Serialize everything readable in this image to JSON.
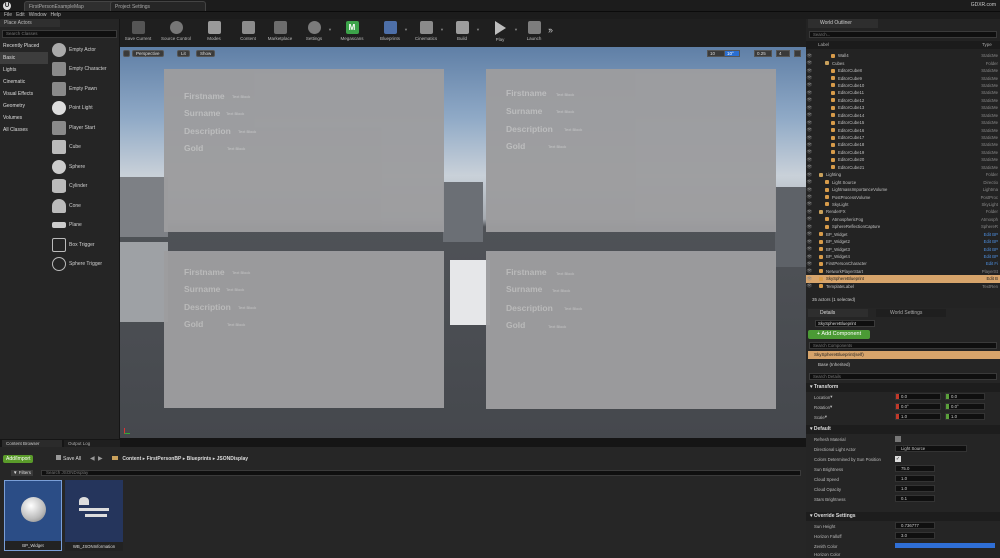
{
  "window": {
    "tabs": [
      "FirstPersonExampleMap",
      "Project Settings"
    ],
    "search": "Search For Help",
    "user": "GDXR.com",
    "fps_text": "11.5 ms"
  },
  "menu": [
    "File",
    "Edit",
    "Window",
    "Help"
  ],
  "toolbar": [
    {
      "label": "Save Current",
      "icon": "save-icon"
    },
    {
      "label": "Source Control",
      "icon": "source-control-icon"
    },
    {
      "label": "Modes",
      "icon": "modes-icon"
    },
    {
      "label": "Content",
      "icon": "content-icon"
    },
    {
      "label": "Marketplace",
      "icon": "marketplace-icon"
    },
    {
      "label": "Settings",
      "icon": "settings-icon"
    },
    {
      "label": "Megascans",
      "icon": "megascans-icon"
    },
    {
      "label": "Blueprints",
      "icon": "blueprints-icon"
    },
    {
      "label": "Cinematics",
      "icon": "cinematics-icon"
    },
    {
      "label": "Build",
      "icon": "build-icon"
    },
    {
      "label": "Play",
      "icon": "play-icon"
    },
    {
      "label": "Launch",
      "icon": "launch-icon"
    }
  ],
  "place_actors": {
    "title": "Place Actors",
    "search_placeholder": "Search Classes",
    "categories": [
      "Recently Placed",
      "Basic",
      "Lights",
      "Cinematic",
      "Visual Effects",
      "Geometry",
      "Volumes",
      "All Classes"
    ],
    "selected_category": "Basic",
    "items": [
      "Empty Actor",
      "Empty Character",
      "Empty Pawn",
      "Point Light",
      "Player Start",
      "Cube",
      "Sphere",
      "Cylinder",
      "Cone",
      "Plane",
      "Box Trigger",
      "Sphere Trigger"
    ]
  },
  "viewport": {
    "buttons": [
      "Perspective",
      "Lit",
      "Show"
    ],
    "fields": [
      "Firstname",
      "Surname",
      "Description",
      "Gold"
    ],
    "value": "Text Block",
    "right_controls": [
      "10",
      "10°",
      "0.25",
      "4"
    ]
  },
  "content_browser": {
    "tabs": [
      "Content Browser",
      "Output Log"
    ],
    "add_import": "Add/Import",
    "save_all": "Save All",
    "path": [
      "Content",
      "FirstPersonBP",
      "Blueprints",
      "JSONDisplay"
    ],
    "filters": "Filters",
    "search_placeholder": "Search JSONDisplay",
    "assets": [
      {
        "name": "BP_Widget",
        "icon": "sphere-asset-icon"
      },
      {
        "name": "WB_JSONInformation",
        "icon": "widget-asset-icon"
      }
    ]
  },
  "outliner": {
    "title": "World Outliner",
    "search_placeholder": "Search...",
    "col_label": "Label",
    "col_type": "Type",
    "rows": [
      {
        "label": "Wall4",
        "type": "StaticMe",
        "indent": 3,
        "sel": false
      },
      {
        "label": "Cubes",
        "type": "Folder",
        "indent": 2,
        "sel": false
      },
      {
        "label": "EditorCube8",
        "type": "StaticMe",
        "indent": 3,
        "sel": false
      },
      {
        "label": "EditorCube9",
        "type": "StaticMe",
        "indent": 3,
        "sel": false
      },
      {
        "label": "EditorCube10",
        "type": "StaticMe",
        "indent": 3,
        "sel": false
      },
      {
        "label": "EditorCube11",
        "type": "StaticMe",
        "indent": 3,
        "sel": false
      },
      {
        "label": "EditorCube12",
        "type": "StaticMe",
        "indent": 3,
        "sel": false
      },
      {
        "label": "EditorCube13",
        "type": "StaticMe",
        "indent": 3,
        "sel": false
      },
      {
        "label": "EditorCube14",
        "type": "StaticMe",
        "indent": 3,
        "sel": false
      },
      {
        "label": "EditorCube15",
        "type": "StaticMe",
        "indent": 3,
        "sel": false
      },
      {
        "label": "EditorCube16",
        "type": "StaticMe",
        "indent": 3,
        "sel": false
      },
      {
        "label": "EditorCube17",
        "type": "StaticMe",
        "indent": 3,
        "sel": false
      },
      {
        "label": "EditorCube18",
        "type": "StaticMe",
        "indent": 3,
        "sel": false
      },
      {
        "label": "EditorCube19",
        "type": "StaticMe",
        "indent": 3,
        "sel": false
      },
      {
        "label": "EditorCube20",
        "type": "StaticMe",
        "indent": 3,
        "sel": false
      },
      {
        "label": "EditorCube21",
        "type": "StaticMe",
        "indent": 3,
        "sel": false
      },
      {
        "label": "Lighting",
        "type": "Folder",
        "indent": 1,
        "sel": false
      },
      {
        "label": "Light Source",
        "type": "Directio",
        "indent": 2,
        "sel": false
      },
      {
        "label": "LightmassImportanceVolume",
        "type": "Lightma",
        "indent": 2,
        "sel": false
      },
      {
        "label": "PostProcessVolume",
        "type": "PostProc",
        "indent": 2,
        "sel": false
      },
      {
        "label": "SkyLight",
        "type": "SkyLight",
        "indent": 2,
        "sel": false
      },
      {
        "label": "RenderFX",
        "type": "Folder",
        "indent": 1,
        "sel": false
      },
      {
        "label": "AtmosphericFog",
        "type": "Atmosph",
        "indent": 2,
        "sel": false
      },
      {
        "label": "SphereReflectionCapture",
        "type": "SphereR",
        "indent": 2,
        "sel": false
      },
      {
        "label": "BP_Widget",
        "type": "Edit BP",
        "indent": 1,
        "sel": false
      },
      {
        "label": "BP_Widget2",
        "type": "Edit BP",
        "indent": 1,
        "sel": false
      },
      {
        "label": "BP_Widget3",
        "type": "Edit BP",
        "indent": 1,
        "sel": false
      },
      {
        "label": "BP_Widget4",
        "type": "Edit BP",
        "indent": 1,
        "sel": false
      },
      {
        "label": "FirstPersonCharacter",
        "type": "Edit Fi",
        "indent": 1,
        "sel": false
      },
      {
        "label": "NetworkPlayerStart",
        "type": "PlayerSt",
        "indent": 1,
        "sel": false
      },
      {
        "label": "SkySphereBlueprint",
        "type": "Edit B",
        "indent": 1,
        "sel": true
      },
      {
        "label": "TemplateLabel",
        "type": "TextRen",
        "indent": 1,
        "sel": false
      }
    ],
    "count": "35 actors (1 selected)"
  },
  "details": {
    "tabs": [
      "Details",
      "World Settings"
    ],
    "name": "SkySphereBlueprint",
    "add_component": "+ Add Component",
    "search_components": "Search Components",
    "component": "SkySphereBlueprint(self)",
    "base": "Base (Inherited)",
    "search_details": "Search Details",
    "transform": {
      "title": "Transform",
      "rows": [
        {
          "label": "Location",
          "x": "0.0",
          "y": "0.0",
          "z": "0.0"
        },
        {
          "label": "Rotation",
          "x": "0.0°",
          "y": "0.0°",
          "z": "0.0°"
        },
        {
          "label": "Scale",
          "x": "1.0",
          "y": "1.0",
          "z": "1.0"
        }
      ]
    },
    "default": {
      "title": "Default",
      "refresh": "Refresh Material",
      "directional": "Directional Light Actor",
      "directional_value": "Light Source",
      "colors": "Colors Determined by Sun Position",
      "rows": [
        {
          "label": "Sun Brightness",
          "value": "75.0"
        },
        {
          "label": "Cloud Speed",
          "value": "1.0"
        },
        {
          "label": "Cloud Opacity",
          "value": "1.0"
        },
        {
          "label": "Stars Brightness",
          "value": "0.1"
        }
      ]
    },
    "override": {
      "title": "Override Settings",
      "rows": [
        {
          "label": "Sun Height",
          "value": "0.736777"
        },
        {
          "label": "Horizon Falloff",
          "value": "3.0"
        },
        {
          "label": "Zenith Color",
          "value": ""
        },
        {
          "label": "Horizon Color",
          "value": ""
        }
      ]
    }
  },
  "colors": {
    "accent": "#2a6ed1",
    "selected": "#d7a46b",
    "add_import": "#5a9b2a"
  }
}
